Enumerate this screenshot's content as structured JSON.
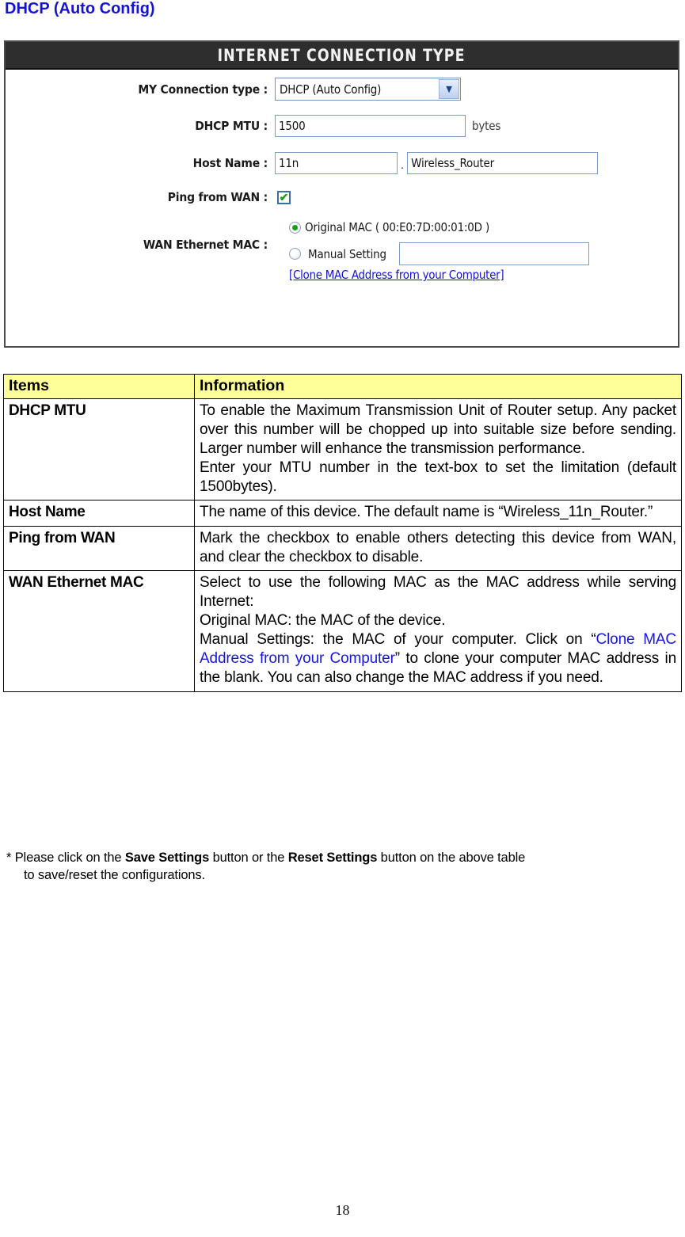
{
  "page": {
    "title": "DHCP (Auto Config)",
    "title_color": "#1414d2",
    "page_number": "18"
  },
  "panel": {
    "header": "INTERNET CONNECTION TYPE",
    "fields": {
      "connection_type": {
        "label": "MY Connection type :",
        "value": "DHCP (Auto Config)",
        "arrow_icon": "chevron-down-icon"
      },
      "dhcp_mtu": {
        "label": "DHCP MTU :",
        "value": "1500",
        "unit": "bytes"
      },
      "host_name": {
        "label": "Host Name :",
        "value_prefix": "11n",
        "separator": ".",
        "value_suffix": "Wireless_Router"
      },
      "ping_from_wan": {
        "label": "Ping from WAN :",
        "checked": true,
        "check_glyph": "✔"
      },
      "wan_ethernet_mac": {
        "label": "WAN Ethernet MAC :",
        "original_option": "Original MAC ( 00:E0:7D:00:01:0D )",
        "original_selected": true,
        "manual_option": "Manual Setting",
        "manual_selected": false,
        "manual_value": "",
        "clone_link": "[Clone MAC Address from your Computer]"
      }
    }
  },
  "table": {
    "headers": [
      "Items",
      "Information"
    ],
    "header_bg": "#ffff99",
    "rows": [
      {
        "item": "DHCP MTU",
        "info": [
          "To enable the Maximum Transmission Unit of Router setup. Any packet over this number will be chopped up into suitable size before sending. Larger number will enhance the transmission performance.",
          "Enter your MTU number in the text-box to set the limitation (default 1500bytes)."
        ]
      },
      {
        "item": "Host Name",
        "info": [
          "The name of this device. The default name is “Wireless_11n_Router.”"
        ]
      },
      {
        "item": "Ping from WAN",
        "info": [
          "Mark the checkbox to enable others detecting this device from WAN, and clear the checkbox to disable."
        ]
      },
      {
        "item": "WAN Ethernet MAC",
        "info_parts": {
          "line1": "Select to use the following MAC as the MAC address while serving Internet:",
          "line2": "Original MAC: the MAC of the device.",
          "line3_before": "Manual Settings: the MAC of your computer. Click on “",
          "line3_link": "Clone MAC Address from your Computer",
          "line3_after": "” to clone your computer MAC address in the blank. You can also change the MAC address if you need."
        }
      }
    ]
  },
  "footnote": {
    "prefix": "* Please click on the ",
    "save_label": "Save Settings",
    "middle": " button or the ",
    "reset_label": "Reset Settings",
    "suffix": " button on the above table",
    "second_line": "to save/reset the configurations."
  }
}
